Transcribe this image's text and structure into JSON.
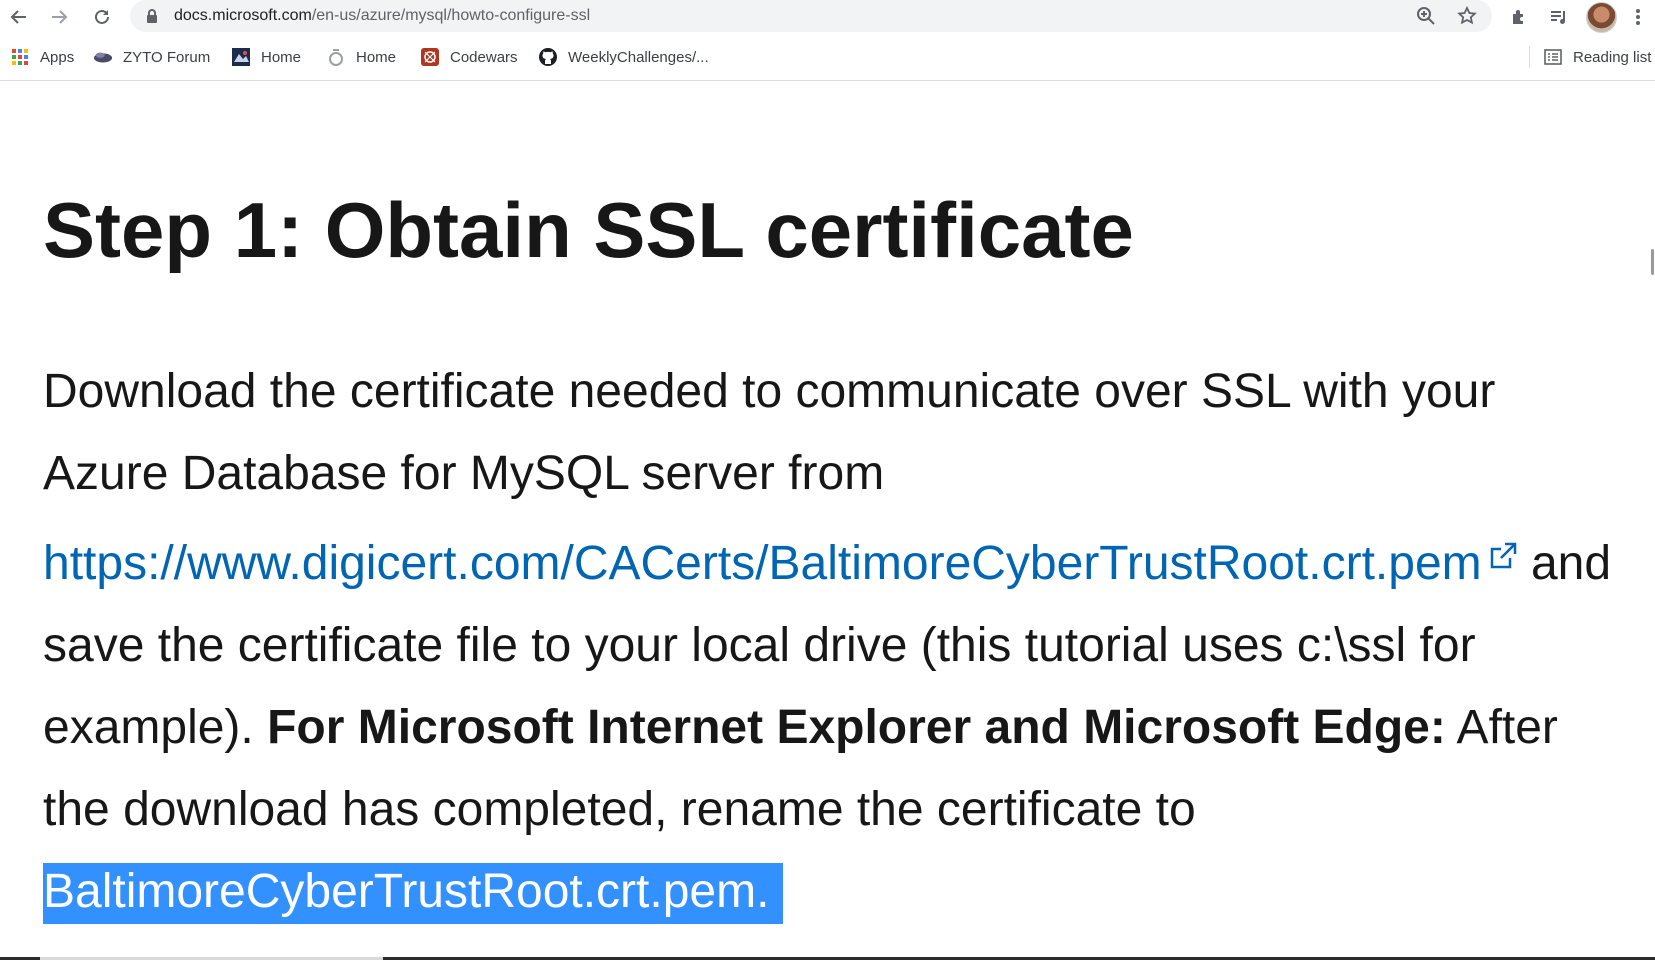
{
  "browser": {
    "url_host": "docs.microsoft.com",
    "url_path": "/en-us/azure/mysql/howto-configure-ssl",
    "bookmarks": [
      {
        "label": "Apps",
        "icon": "apps-grid-icon"
      },
      {
        "label": "ZYTO Forum",
        "icon": "zyto-icon"
      },
      {
        "label": "Home",
        "icon": "home-site-icon"
      },
      {
        "label": "Home",
        "icon": "home-ring-icon"
      },
      {
        "label": "Codewars",
        "icon": "codewars-icon"
      },
      {
        "label": "WeeklyChallenges/...",
        "icon": "github-icon"
      }
    ],
    "reading_list_label": "Reading list"
  },
  "article": {
    "heading": "Step 1: Obtain SSL certificate",
    "text_1": "Download the certificate needed to communicate over SSL with your Azure Database for MySQL server from ",
    "link": "https://www.digicert.com/CACerts/BaltimoreCyberTrustRoot.crt.pem",
    "text_2": " and save the certificate file to your local drive (this tutorial uses c:\\ssl for example). ",
    "bold": "For Microsoft Internet Explorer and Microsoft Edge:",
    "text_3": " After the download has completed, rename the certificate to ",
    "highlighted": "BaltimoreCyberTrustRoot.crt.pem."
  },
  "colors": {
    "link": "#0065b3",
    "selection": "#3390ff",
    "heading": "#171717"
  }
}
